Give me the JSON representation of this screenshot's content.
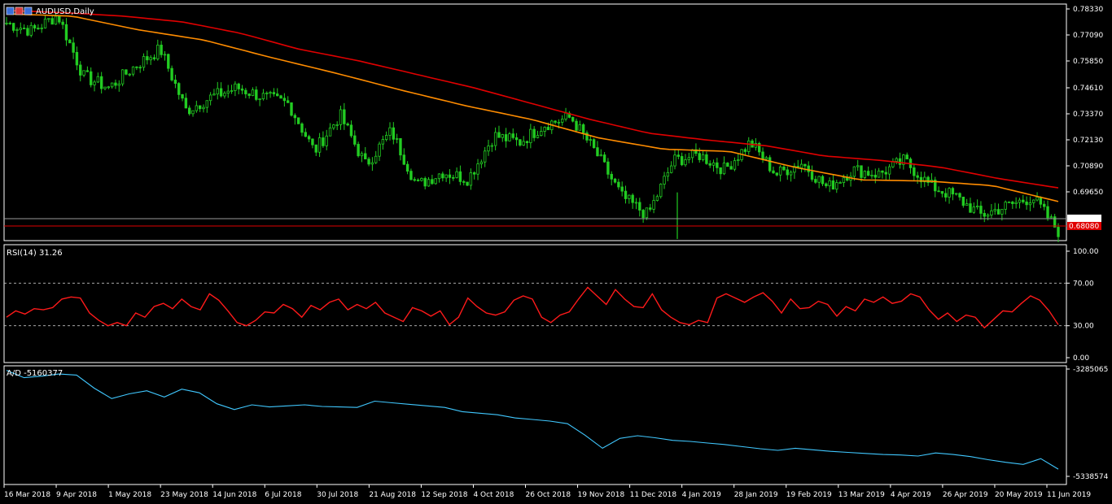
{
  "window": {
    "symbol_title": "AUDUSD,Daily",
    "icon": "window-icon"
  },
  "colors": {
    "background": "#000000",
    "frame": "#ffffff",
    "bull_candle": "#22cc22",
    "bear_candle": "#22cc22",
    "ma_slow": "#e00000",
    "ma_fast": "#ff8c00",
    "rsi_line": "#ff1a1a",
    "ad_line": "#40c8ff",
    "grid_dash": "#c0c0c0",
    "bid_label_bg": "#ffffff",
    "ask_label_bg": "#e00000"
  },
  "chart_data": [
    {
      "type": "candlestick",
      "title": "AUDUSD,Daily",
      "y_ticks": [
        "0.78330",
        "0.77090",
        "0.75850",
        "0.74610",
        "0.73370",
        "0.72130",
        "0.70890",
        "0.69650"
      ],
      "ylim": [
        0.6808,
        0.7848
      ],
      "current_price": "0.68347",
      "ask_price": "0.68080",
      "x_labels": [
        "16 Mar 2018",
        "9 Apr 2018",
        "1 May 2018",
        "23 May 2018",
        "14 Jun 2018",
        "6 Jul 2018",
        "30 Jul 2018",
        "21 Aug 2018",
        "12 Sep 2018",
        "4 Oct 2018",
        "26 Oct 2018",
        "19 Nov 2018",
        "11 Dec 2018",
        "4 Jan 2019",
        "28 Jan 2019",
        "19 Feb 2019",
        "13 Mar 2019",
        "4 Apr 2019",
        "26 Apr 2019",
        "20 May 2019",
        "11 Jun 2019"
      ],
      "close_anchors": [
        0.7765,
        0.773,
        0.78,
        0.753,
        0.748,
        0.7575,
        0.765,
        0.738,
        0.744,
        0.748,
        0.744,
        0.741,
        0.72,
        0.736,
        0.714,
        0.729,
        0.705,
        0.711,
        0.708,
        0.727,
        0.724,
        0.732,
        0.735,
        0.719,
        0.7,
        0.692,
        0.716,
        0.7185,
        0.712,
        0.724,
        0.71,
        0.715,
        0.704,
        0.712,
        0.71,
        0.716,
        0.705,
        0.7,
        0.692,
        0.696,
        0.7,
        0.685
      ],
      "moving_averages": [
        {
          "anchors": [
            0.7805,
            0.7795,
            0.7735,
            0.769,
            0.7615,
            0.7545,
            0.747,
            0.74,
            0.734,
            0.726,
            0.721,
            0.72,
            0.713,
            0.7075,
            0.707,
            0.705,
            0.698
          ]
        },
        {
          "anchors": [
            0.782,
            0.781,
            0.7795,
            0.777,
            0.772,
            0.765,
            0.76,
            0.754,
            0.748,
            0.741,
            0.734,
            0.728,
            0.725,
            0.7225,
            0.718,
            0.716,
            0.713,
            0.708,
            0.704
          ]
        }
      ]
    },
    {
      "type": "line",
      "title": "RSI(14) 31.26",
      "y_ticks": [
        "100.00",
        "70.00",
        "30.00",
        "0.00"
      ],
      "ylim": [
        0,
        100
      ],
      "levels": [
        70,
        30
      ],
      "values": [
        38,
        44,
        41,
        46,
        45,
        47,
        55,
        57,
        56,
        42,
        35,
        30,
        33,
        30,
        42,
        38,
        48,
        51,
        46,
        55,
        48,
        45,
        60,
        54,
        44,
        33,
        30,
        35,
        43,
        42,
        50,
        46,
        38,
        49,
        45,
        52,
        55,
        45,
        50,
        46,
        52,
        42,
        38,
        34,
        47,
        44,
        39,
        44,
        31,
        38,
        56,
        48,
        42,
        40,
        43,
        54,
        58,
        55,
        38,
        33,
        40,
        43,
        55,
        66,
        58,
        50,
        64,
        55,
        48,
        47,
        60,
        45,
        38,
        33,
        31,
        35,
        33,
        56,
        60,
        56,
        52,
        57,
        61,
        53,
        42,
        55,
        46,
        47,
        53,
        50,
        39,
        48,
        44,
        55,
        52,
        57,
        51,
        53,
        60,
        57,
        45,
        36,
        42,
        34,
        40,
        38,
        28,
        36,
        44,
        43,
        51,
        58,
        54,
        44,
        31
      ]
    },
    {
      "type": "line",
      "title": "A/D -5160377",
      "y_ticks": [
        "-3285065",
        "-5338574"
      ],
      "ylim": [
        -5338574,
        -3285065
      ],
      "values": [
        -3310000,
        -3450000,
        -3420000,
        -3380000,
        -3400000,
        -3650000,
        -3850000,
        -3760000,
        -3700000,
        -3820000,
        -3670000,
        -3740000,
        -3950000,
        -4060000,
        -3970000,
        -4010000,
        -3990000,
        -3970000,
        -4000000,
        -4010000,
        -4020000,
        -3900000,
        -3930000,
        -3960000,
        -3990000,
        -4020000,
        -4100000,
        -4130000,
        -4160000,
        -4220000,
        -4250000,
        -4280000,
        -4330000,
        -4550000,
        -4800000,
        -4610000,
        -4560000,
        -4600000,
        -4650000,
        -4670000,
        -4700000,
        -4730000,
        -4770000,
        -4810000,
        -4840000,
        -4800000,
        -4830000,
        -4860000,
        -4880000,
        -4900000,
        -4920000,
        -4930000,
        -4950000,
        -4890000,
        -4920000,
        -4960000,
        -5020000,
        -5070000,
        -5110000,
        -5000000,
        -5200000
      ]
    }
  ]
}
